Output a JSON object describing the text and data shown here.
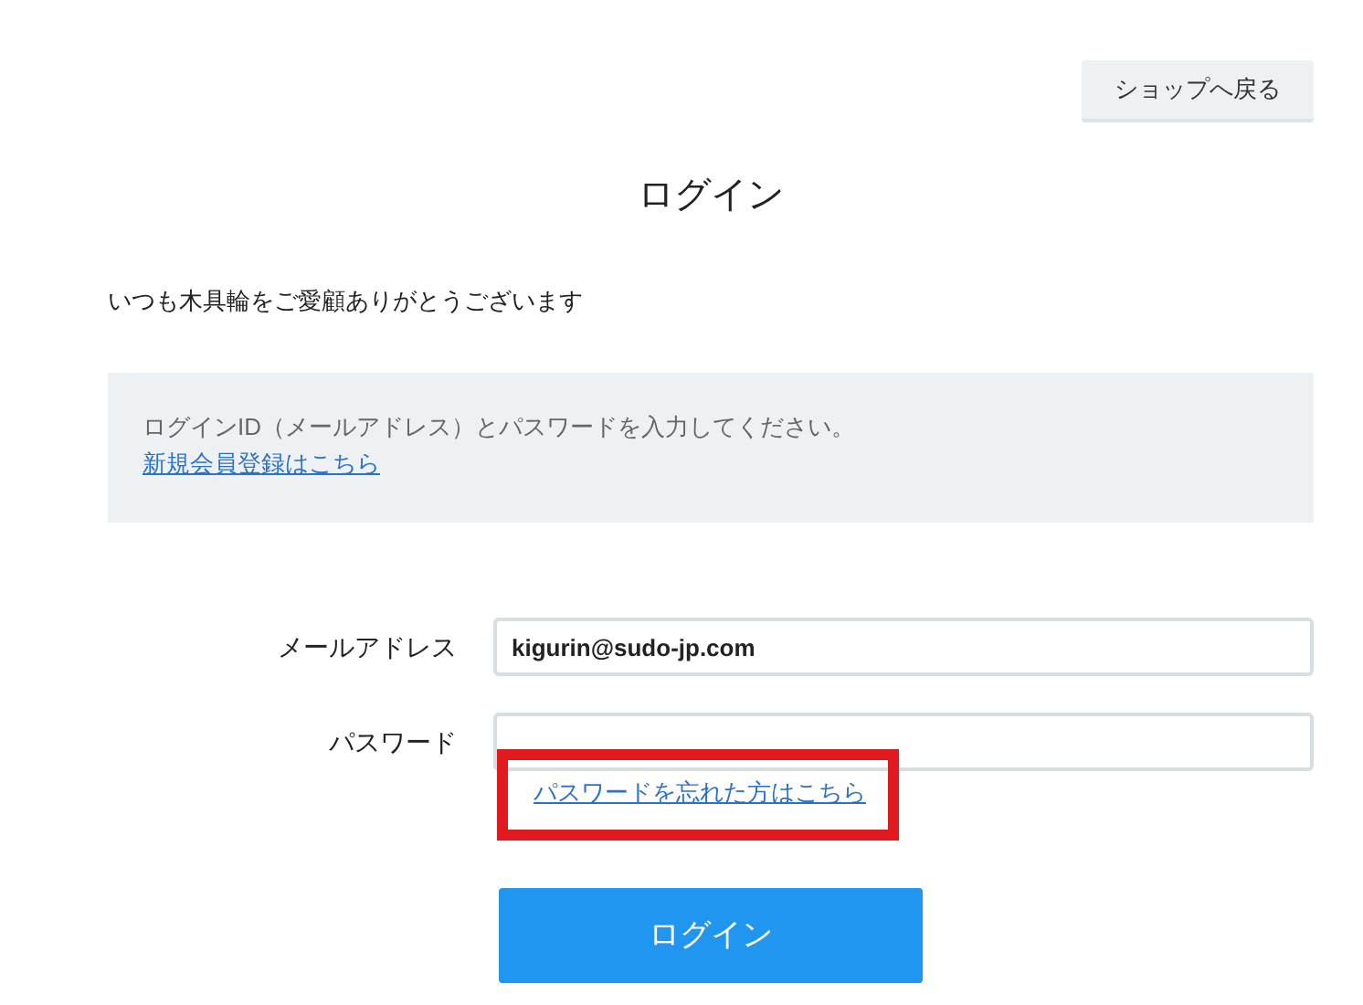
{
  "back_button": "ショップへ戻る",
  "title": "ログイン",
  "greeting": "いつも木具輪をご愛顧ありがとうございます",
  "notice": {
    "text": "ログインID（メールアドレス）とパスワードを入力してください。",
    "link": "新規会員登録はこちら"
  },
  "fields": [
    {
      "label": "メールアドレス",
      "value": "kigurin@sudo-jp.com",
      "kind": "email"
    },
    {
      "label": "パスワード",
      "kind": "password"
    }
  ],
  "forgot_link": {
    "text": "パスワードを忘れた方はこちら",
    "highlighted": true
  },
  "submit_button": "ログイン"
}
